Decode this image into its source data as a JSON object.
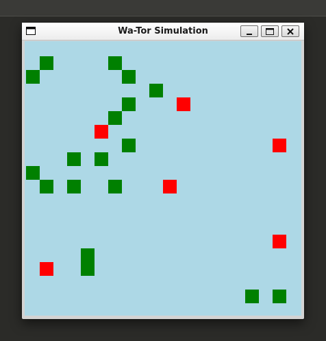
{
  "window": {
    "title": "Wa-Tor Simulation"
  },
  "icons": {
    "app": "window-icon",
    "minimize": "minimize-icon",
    "maximize": "maximize-icon",
    "close": "close-icon"
  },
  "colors": {
    "ocean": "#add8e6",
    "fish": "#008000",
    "shark": "#ff0000"
  },
  "grid": {
    "cell_units": 1
  },
  "fish": [
    [
      1,
      1
    ],
    [
      6,
      1
    ],
    [
      0,
      2
    ],
    [
      7,
      2
    ],
    [
      9,
      3
    ],
    [
      7,
      4
    ],
    [
      6,
      5
    ],
    [
      7,
      7
    ],
    [
      3,
      8
    ],
    [
      5,
      8
    ],
    [
      0,
      9
    ],
    [
      1,
      10
    ],
    [
      3,
      10
    ],
    [
      6,
      10
    ],
    [
      4,
      15
    ],
    [
      4,
      16
    ],
    [
      16,
      18
    ],
    [
      18,
      18
    ]
  ],
  "sharks": [
    [
      11,
      4
    ],
    [
      5,
      6
    ],
    [
      18,
      7
    ],
    [
      10,
      10
    ],
    [
      18,
      14
    ],
    [
      1,
      16
    ]
  ]
}
